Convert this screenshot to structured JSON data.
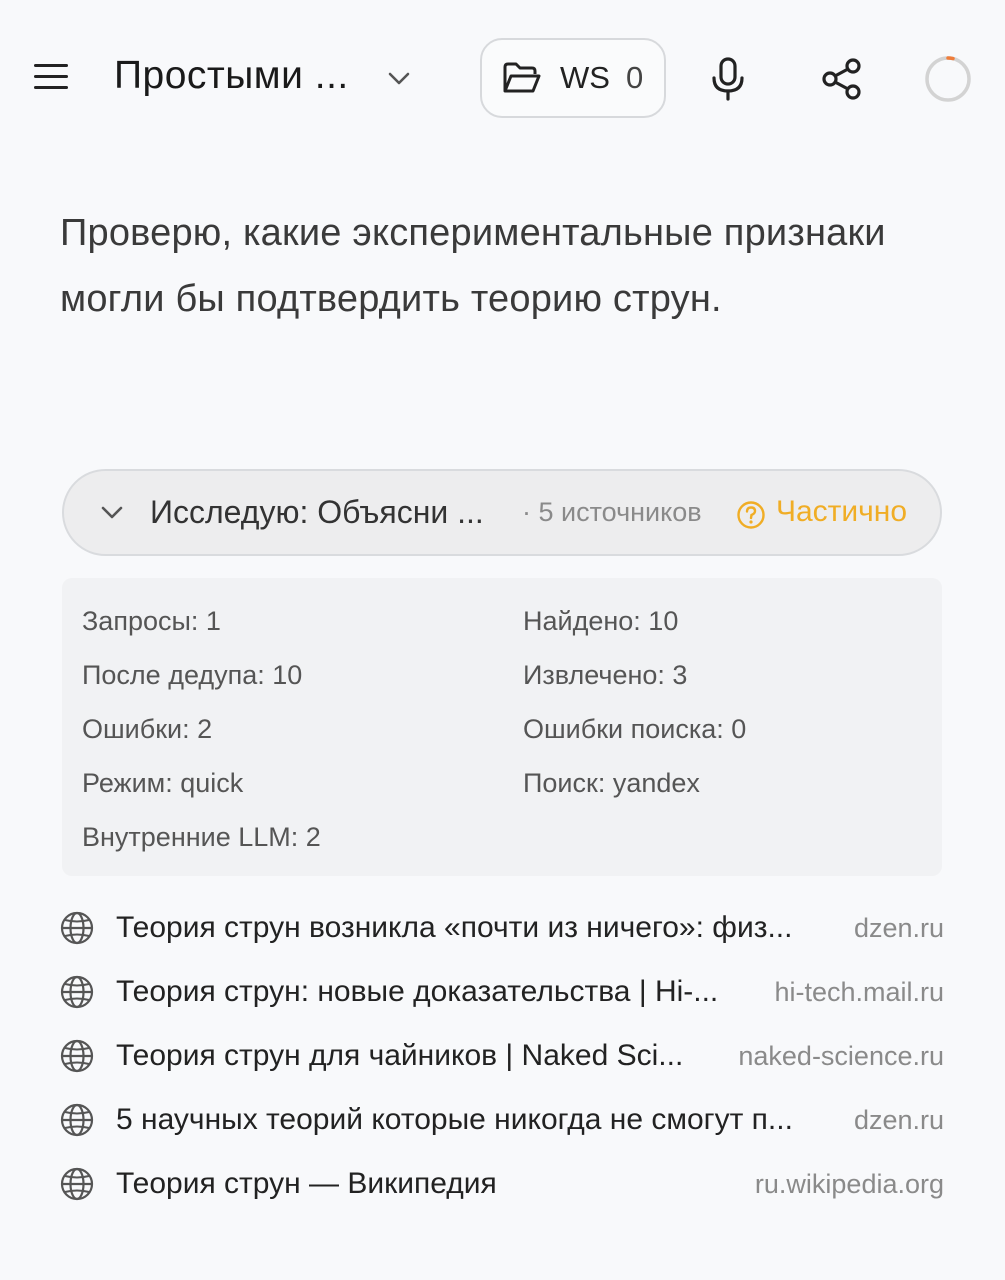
{
  "header": {
    "title": "Простыми ...",
    "workspace_label": "WS",
    "workspace_count": "0"
  },
  "message": {
    "text": "Проверю, какие экспериментальные признаки могли бы подтвердить теорию струн."
  },
  "research": {
    "title": "Исследую: Объясни ...",
    "sources_count": "· 5 источников",
    "status": "Частично",
    "status_color": "#f0ad25"
  },
  "stats": {
    "queries": "Запросы: 1",
    "found": "Найдено: 10",
    "after_dedup": "После дедупа: 10",
    "extracted": "Извлечено: 3",
    "errors": "Ошибки: 2",
    "search_errors": "Ошибки поиска: 0",
    "mode": "Режим: quick",
    "search": "Поиск: yandex",
    "internal_llm": "Внутренние LLM: 2"
  },
  "sources": [
    {
      "title": "Теория струн возникла «почти из ничего»: физ...",
      "domain": "dzen.ru",
      "icon": "globe-icon"
    },
    {
      "title": "Теория струн: новые доказательства | Hi-...",
      "domain": "hi-tech.mail.ru",
      "icon": "globe-icon"
    },
    {
      "title": "Теория струн для чайников | Naked Sci...",
      "domain": "naked-science.ru",
      "icon": "globe-icon"
    },
    {
      "title": "5 научных теорий которые никогда не смогут п...",
      "domain": "dzen.ru",
      "icon": "globe-icon"
    },
    {
      "title": "Теория струн — Википедия",
      "domain": "ru.wikipedia.org",
      "icon": "globe-icon"
    }
  ]
}
